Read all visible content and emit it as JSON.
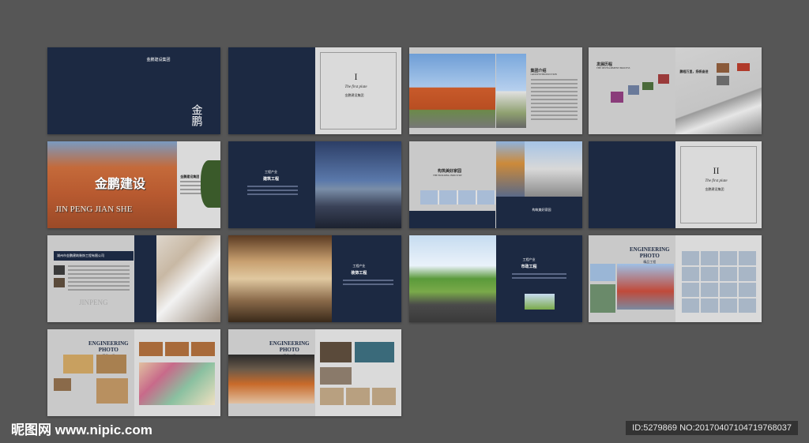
{
  "cover": {
    "brand": "金鹏建设集团",
    "title": "金鹏"
  },
  "spread2": {
    "chapter": "I",
    "subtitle": "The first plate",
    "heading": "金鹏建设集团"
  },
  "spread3": {
    "title": "集团介绍",
    "subtitle": "GROUP INTRODUCTION"
  },
  "spread4": {
    "title": "发展历程",
    "subtitle": "THE DEVELOPMENT PROCESS",
    "side": "鹏程万里，扬帆奋进"
  },
  "spread5": {
    "sign_cn": "金鹏建设",
    "sign_en": "JIN PENG JIAN SHE",
    "title": "金鹏建设集团"
  },
  "spread6": {
    "title": "建筑工程",
    "tag": "工程产业"
  },
  "spread7": {
    "title": "构筑美好家园",
    "subtitle": "THE BUILDING INDUSTRY"
  },
  "spread8": {
    "chapter": "II",
    "subtitle": "The first plate",
    "heading": "金鹏建设集团"
  },
  "spread9": {
    "title": "湖州市金鹏建筑装饰工程有限公司",
    "logo_text": "JINPENG"
  },
  "spread10": {
    "title": "装饰工程",
    "tag": "工程产业"
  },
  "spread11": {
    "title": "市政工程",
    "tag": "工程产业"
  },
  "spread12": {
    "title1": "ENGINEERING",
    "title2": "PHOTO",
    "tag": "精品工程"
  },
  "spread13": {
    "title1": "ENGINEERING",
    "title2": "PHOTO",
    "tag": "精品工程"
  },
  "spread14": {
    "title1": "ENGINEERING",
    "title2": "PHOTO",
    "tag": "精品工程"
  },
  "watermark": {
    "site": "昵图网 www.nipic.com",
    "id": "ID:5279869 NO:20170407104719768037"
  },
  "colors": {
    "background": "#565656",
    "navy": "#1c2942",
    "gray": "#c9c9c9"
  }
}
